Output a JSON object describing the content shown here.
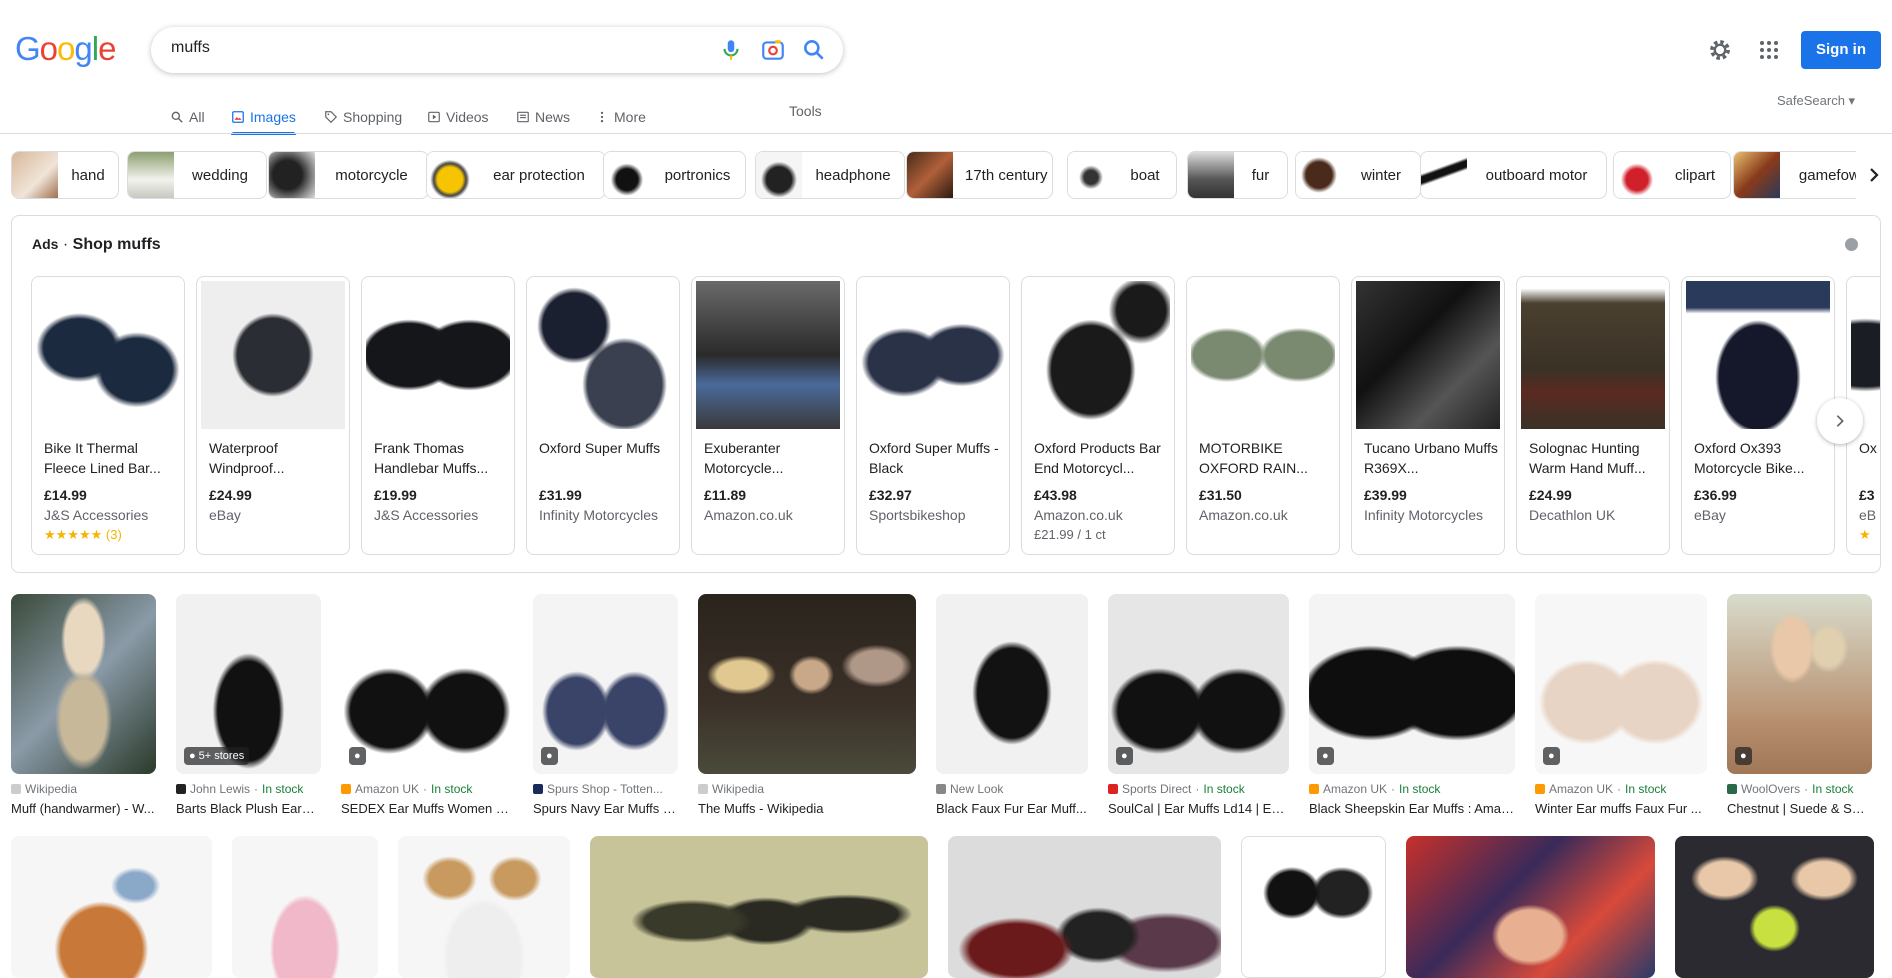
{
  "logo": {
    "text": "Google"
  },
  "search": {
    "value": "muffs"
  },
  "header": {
    "sign_in": "Sign in",
    "safesearch": "SafeSearch ▾"
  },
  "tabs": [
    {
      "label": "All"
    },
    {
      "label": "Images"
    },
    {
      "label": "Shopping"
    },
    {
      "label": "Videos"
    },
    {
      "label": "News"
    },
    {
      "label": "More"
    }
  ],
  "tools": "Tools",
  "chips": [
    {
      "label": "hand"
    },
    {
      "label": "wedding"
    },
    {
      "label": "motorcycle"
    },
    {
      "label": "ear protection"
    },
    {
      "label": "portronics"
    },
    {
      "label": "headphone"
    },
    {
      "label": "17th century"
    },
    {
      "label": "boat"
    },
    {
      "label": "fur"
    },
    {
      "label": "winter"
    },
    {
      "label": "outboard motor"
    },
    {
      "label": "clipart"
    },
    {
      "label": "gamefowl"
    }
  ],
  "ads": {
    "label": "Ads",
    "title": "Shop muffs",
    "products": [
      {
        "name": "Bike It Thermal Fleece Lined Bar...",
        "price": "£14.99",
        "store": "J&S Accessories",
        "extra": "★★★★★ (3)"
      },
      {
        "name": "Waterproof Windproof...",
        "price": "£24.99",
        "store": "eBay",
        "extra": ""
      },
      {
        "name": "Frank Thomas Handlebar Muffs...",
        "price": "£19.99",
        "store": "J&S Accessories",
        "extra": ""
      },
      {
        "name": "Oxford Super Muffs",
        "price": "£31.99",
        "store": "Infinity Motorcycles",
        "extra": ""
      },
      {
        "name": "Exuberanter Motorcycle...",
        "price": "£11.89",
        "store": "Amazon.co.uk",
        "extra": ""
      },
      {
        "name": "Oxford Super Muffs - Black",
        "price": "£32.97",
        "store": "Sportsbikeshop",
        "extra": ""
      },
      {
        "name": "Oxford Products Bar End Motorcycl...",
        "price": "£43.98",
        "store": "Amazon.co.uk",
        "extra": "£21.99 / 1 ct"
      },
      {
        "name": "MOTORBIKE OXFORD RAIN...",
        "price": "£31.50",
        "store": "Amazon.co.uk",
        "extra": ""
      },
      {
        "name": "Tucano Urbano Muffs R369X...",
        "price": "£39.99",
        "store": "Infinity Motorcycles",
        "extra": ""
      },
      {
        "name": "Solognac Hunting Warm Hand Muff...",
        "price": "£24.99",
        "store": "Decathlon UK",
        "extra": ""
      },
      {
        "name": "Oxford Ox393 Motorcycle Bike...",
        "price": "£36.99",
        "store": "eBay",
        "extra": ""
      },
      {
        "name": "Ox Mo",
        "price": "£3",
        "store": "eB",
        "extra": "★"
      }
    ]
  },
  "results_row1": [
    {
      "source": "Wikipedia",
      "stock": "",
      "title": "Muff (handwarmer) - W...",
      "badge": ""
    },
    {
      "source": "John Lewis",
      "stock": "In stock",
      "title": "Barts Black Plush Earm...",
      "badge": "5+ stores"
    },
    {
      "source": "Amazon UK",
      "stock": "In stock",
      "title": "SEDEX Ear Muffs Women Gi...",
      "badge": "tag"
    },
    {
      "source": "Spurs Shop - Totten...",
      "stock": "",
      "title": "Spurs Navy Ear Muffs | ...",
      "badge": "tag"
    },
    {
      "source": "Wikipedia",
      "stock": "",
      "title": "The Muffs - Wikipedia",
      "badge": ""
    },
    {
      "source": "New Look",
      "stock": "",
      "title": "Black Faux Fur Ear Muff...",
      "badge": ""
    },
    {
      "source": "Sports Direct",
      "stock": "In stock",
      "title": "SoulCal | Ear Muffs Ld14 | Ear...",
      "badge": "tag"
    },
    {
      "source": "Amazon UK",
      "stock": "In stock",
      "title": "Black Sheepskin Ear Muffs : Amaz...",
      "badge": "tag"
    },
    {
      "source": "Amazon UK",
      "stock": "In stock",
      "title": "Winter Ear muffs Faux Fur ...",
      "badge": "tag"
    },
    {
      "source": "WoolOvers",
      "stock": "In stock",
      "title": "Chestnut | Suede & She...",
      "badge": "tag"
    }
  ],
  "colors": {
    "accent": "#1a73e8",
    "in_stock": "#188038",
    "border": "#dadce0",
    "star": "#f5b400"
  }
}
